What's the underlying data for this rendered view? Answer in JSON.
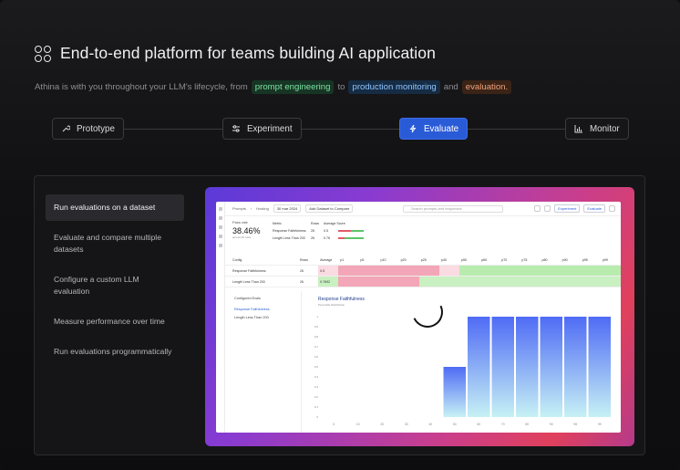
{
  "hero": {
    "title": "End-to-end platform for teams building AI application",
    "subtitle_prefix": "Athina is with you throughout your LLM's lifecycle, from",
    "pill_1": "prompt engineering",
    "joiner_1": "to",
    "pill_2": "production monitoring",
    "joiner_2": "and",
    "pill_3": "evaluation."
  },
  "steps": [
    {
      "label": "Prototype",
      "icon": "wrench-icon"
    },
    {
      "label": "Experiment",
      "icon": "sliders-icon"
    },
    {
      "label": "Evaluate",
      "icon": "lightning-icon",
      "active": true
    },
    {
      "label": "Monitor",
      "icon": "bar-chart-icon"
    }
  ],
  "menu": [
    {
      "label": "Run evaluations on a dataset",
      "active": true
    },
    {
      "label": "Evaluate and compare multiple datasets"
    },
    {
      "label": "Configure a custom LLM evaluation"
    },
    {
      "label": "Measure performance over time"
    },
    {
      "label": "Run evaluations programmatically"
    }
  ],
  "app": {
    "breadcrumb_1": "Prompts",
    "breadcrumb_2": "Hosting",
    "date_chip": "30 mar 2024",
    "add_dataset": "Add Dataset to Compare",
    "search_placeholder": "Search prompts and responses",
    "experiment_btn": "Experiment",
    "evaluate_btn": "Evaluate",
    "pass_rate_label": "Pass rate",
    "pass_rate_value": "38.46%",
    "pass_rate_sub": "across 26 rows",
    "metrics_headers": [
      "Metric",
      "Rows",
      "Average Score"
    ],
    "metrics_rows": [
      {
        "name": "Response Faithfulness",
        "rows": "26",
        "score": "0.5"
      },
      {
        "name": "Length Less Than 200",
        "rows": "26",
        "score": "0.76"
      }
    ],
    "table_headers": [
      "Config",
      "Rows",
      "Average",
      "p1",
      "p5",
      "p10",
      "p20",
      "p25",
      "p40",
      "p50",
      "p60",
      "p70",
      "p75",
      "p80",
      "p90",
      "p95",
      "p99"
    ],
    "table_rows": [
      {
        "name": "Response Faithfulness",
        "rows": "26",
        "avg": "0.5"
      },
      {
        "name": "Length Less Than 200",
        "rows": "26",
        "avg": "0.7692"
      }
    ],
    "configured_evals_label": "Configured Evals",
    "eval_1": "Response Faithfulness",
    "eval_2": "Length Less Than 200"
  },
  "chart_data": {
    "type": "bar",
    "title": "Response Faithfulness",
    "subtitle": "Percentile Distribution",
    "categories": [
      "0",
      "10",
      "20",
      "30",
      "40",
      "50",
      "60",
      "70",
      "80",
      "90",
      "95",
      "99"
    ],
    "values": [
      0,
      0,
      0,
      0,
      0,
      0.5,
      1,
      1,
      1,
      1,
      1,
      1
    ],
    "ylim": [
      0,
      1
    ],
    "yticks": [
      "0",
      "0.1",
      "0.2",
      "0.3",
      "0.4",
      "0.5",
      "0.6",
      "0.7",
      "0.8",
      "0.9",
      "1"
    ],
    "bar_color": "#4f6bf5",
    "bar_fade_color": "#c7f1f5"
  },
  "colors": {
    "accent": "#2a5bd7",
    "pill_green_text": "#7ee2a2",
    "pill_blue_text": "#8fc4ff",
    "pill_orange_text": "#f2a27a"
  }
}
